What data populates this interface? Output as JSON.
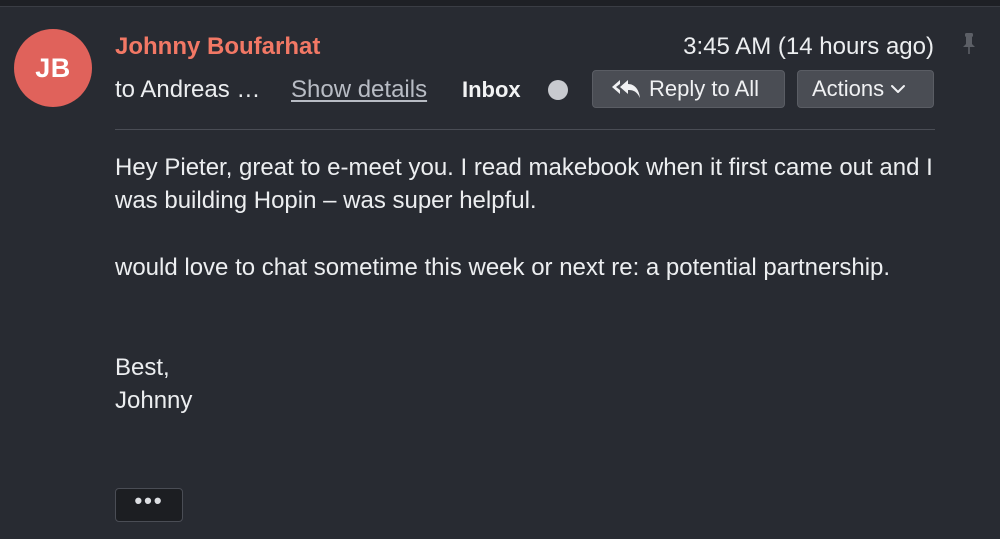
{
  "message": {
    "avatar_initials": "JB",
    "sender_name": "Johnny Boufarhat",
    "timestamp": "3:45 AM (14 hours ago)",
    "recipients": "to Andreas …",
    "show_details_label": "Show details",
    "folder_label": "Inbox",
    "body": {
      "paragraph_1": "Hey Pieter, great to e-meet you. I read makebook when it first came out and I was building Hopin – was super helpful.",
      "paragraph_2": "would love to chat sometime this week or next re: a potential partnership.",
      "signoff": "Best,",
      "signature": "Johnny"
    }
  },
  "toolbar": {
    "reply_all_label": "Reply to All",
    "actions_label": "Actions",
    "more_label": "•••"
  },
  "icons": {
    "pin": "pin-icon",
    "reply_all": "reply-all-icon",
    "chevron": "chevron-down-icon",
    "unread": "unread-dot-icon"
  },
  "colors": {
    "background": "#282b32",
    "avatar": "#e0625b",
    "sender": "#f27865",
    "button": "#4a4d54"
  }
}
